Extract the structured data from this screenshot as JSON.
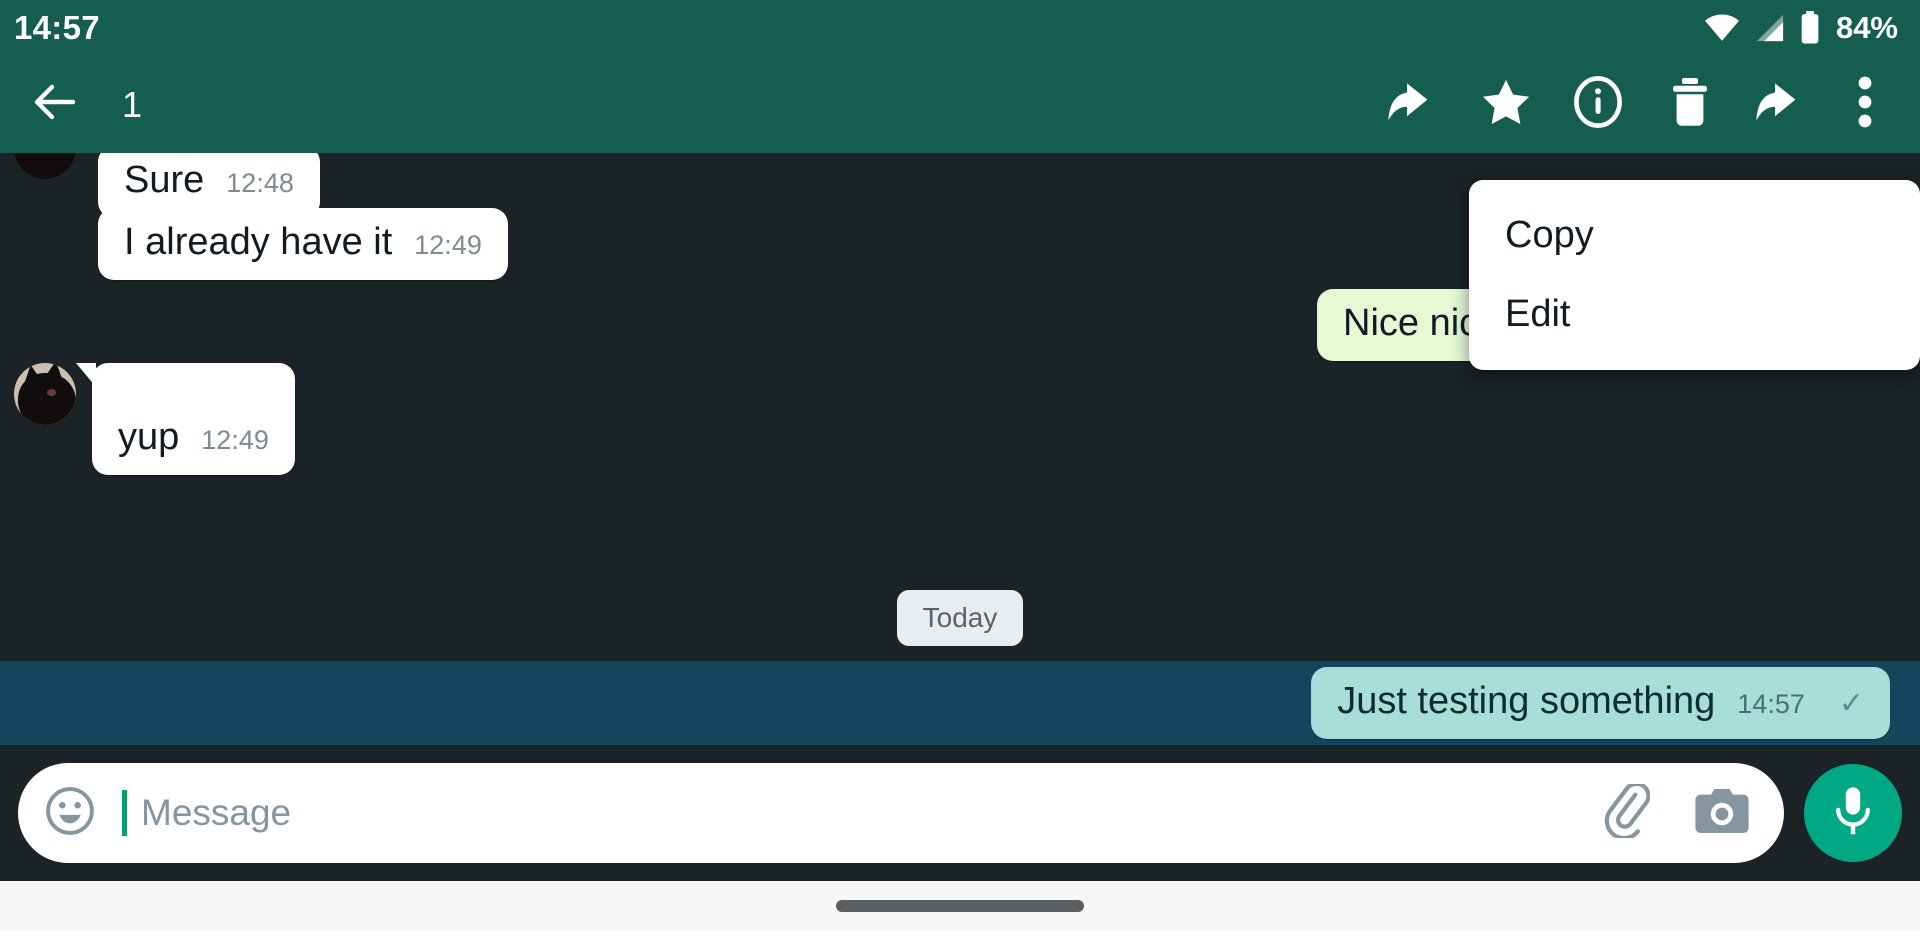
{
  "status_bar": {
    "time": "14:57",
    "battery_text": "84%",
    "icons": [
      "wifi-icon",
      "cellular-signal-icon",
      "battery-icon"
    ]
  },
  "toolbar": {
    "back_icon": "back-arrow-icon",
    "selected_count": "1",
    "actions": [
      {
        "name": "reply-icon",
        "label": "Reply"
      },
      {
        "name": "star-icon",
        "label": "Star"
      },
      {
        "name": "info-icon",
        "label": "Info"
      },
      {
        "name": "delete-icon",
        "label": "Delete"
      },
      {
        "name": "forward-icon",
        "label": "Forward"
      },
      {
        "name": "overflow-menu-icon",
        "label": "More options"
      }
    ]
  },
  "menu": {
    "items": [
      {
        "label": "Copy"
      },
      {
        "label": "Edit"
      }
    ]
  },
  "chat": {
    "date_divider": "Today",
    "messages": [
      {
        "text": "Sure",
        "time": "12:48",
        "direction": "in"
      },
      {
        "text": "I already have it",
        "time": "12:49",
        "direction": "in"
      },
      {
        "text": "Nice nic",
        "time": "",
        "direction": "out"
      },
      {
        "text": "yup",
        "time": "12:49",
        "direction": "in"
      },
      {
        "text": "Just testing something",
        "time": "14:57",
        "direction": "out",
        "status": "sent",
        "selected": true
      }
    ]
  },
  "composer": {
    "placeholder": "Message",
    "value": "",
    "emoji_icon": "emoji-smiley-icon",
    "attach_icon": "paperclip-icon",
    "camera_icon": "camera-icon",
    "mic_icon": "microphone-icon"
  },
  "colors": {
    "toolbar_green": "#155d4e",
    "chat_background": "#1b2326",
    "incoming_bubble": "#ffffff",
    "outgoing_bubble": "#e7f8d5",
    "selected_bubble": "#a7dfd8",
    "selection_row": "#14455c",
    "mic_button": "#00a884",
    "caret_green": "#0a9e6e"
  }
}
